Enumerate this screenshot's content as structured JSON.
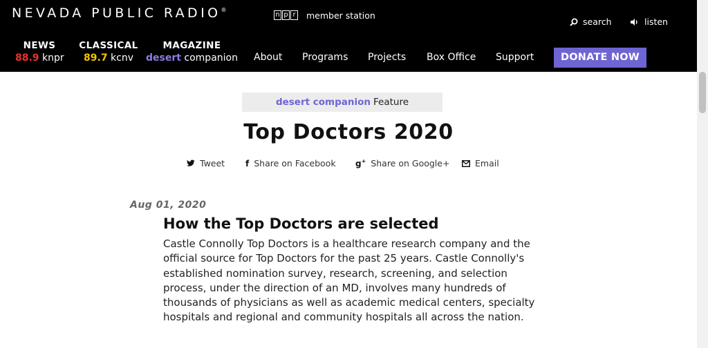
{
  "header": {
    "logo_text": "NEVADA PUBLIC RADIO",
    "logo_mark": "®",
    "npr_letters": [
      "n",
      "p",
      "r"
    ],
    "member_text": "member station",
    "search_label": "search",
    "listen_label": "listen"
  },
  "brands": {
    "news": {
      "title": "NEWS",
      "freq": "88.9",
      "call": "knpr"
    },
    "classical": {
      "title": "CLASSICAL",
      "freq": "89.7",
      "call": "kcnv"
    },
    "magazine": {
      "title": "MAGAZINE",
      "name_bold": "desert",
      "name_rest": "companion"
    }
  },
  "nav": {
    "about": "About",
    "programs": "Programs",
    "projects": "Projects",
    "box_office": "Box Office",
    "support": "Support",
    "donate": "DONATE NOW"
  },
  "feature": {
    "brand": "desert companion",
    "label": "Feature"
  },
  "article": {
    "title": "Top Doctors 2020",
    "date": "Aug 01, 2020",
    "heading": "How the Top Doctors are selected",
    "body": "Castle Connolly Top Doctors is a healthcare research company and the official source for Top Doctors for the past 25 years. Castle Connolly's established nomination survey, research, screening, and selection process, under the direction of an MD, involves many hundreds of thousands of physicians as well as academic medical centers, specialty hospitals and regional and community hospitals all across the nation."
  },
  "share": {
    "tweet": "Tweet",
    "facebook": "Share on Facebook",
    "google": "Share on Google+",
    "email": "Email"
  },
  "icons": {
    "search": "search-icon",
    "listen": "speaker-icon",
    "tweet": "twitter-icon",
    "facebook": "facebook-icon",
    "google": "google-plus-icon",
    "email": "envelope-icon"
  },
  "colors": {
    "topbar": "#000000",
    "news_red": "#e8322e",
    "classical_yellow": "#f5c400",
    "accent_purple": "#6e64d2",
    "feature_bg": "#ececec"
  }
}
